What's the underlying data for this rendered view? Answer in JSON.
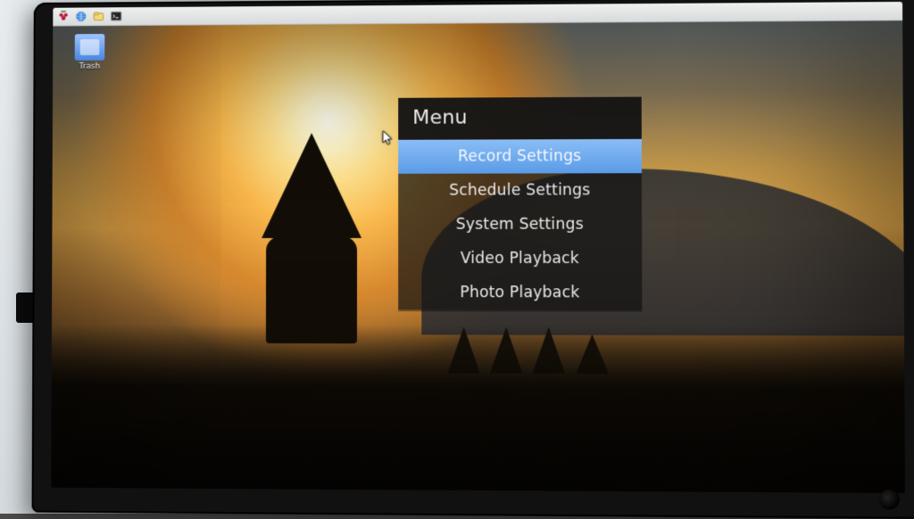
{
  "taskbar": {
    "icons": [
      "raspberry-icon",
      "globe-icon",
      "files-icon",
      "terminal-icon"
    ]
  },
  "desktop": {
    "trash_label": "Trash"
  },
  "osd": {
    "title": "Menu",
    "items": [
      {
        "label": "Record Settings",
        "selected": true
      },
      {
        "label": "Schedule Settings",
        "selected": false
      },
      {
        "label": "System Settings",
        "selected": false
      },
      {
        "label": "Video Playback",
        "selected": false
      },
      {
        "label": "Photo Playback",
        "selected": false
      }
    ]
  }
}
